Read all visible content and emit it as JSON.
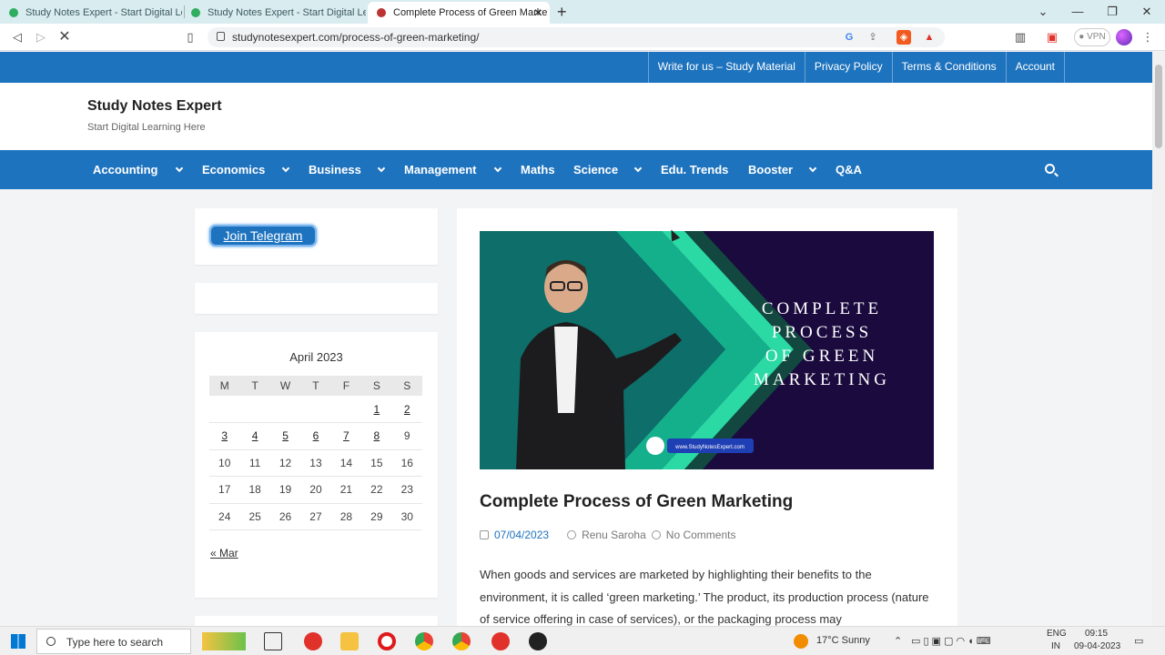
{
  "browser": {
    "tabs": [
      {
        "title": "Study Notes Expert - Start Digital Lear"
      },
      {
        "title": "Study Notes Expert - Start Digital Lear"
      },
      {
        "title": "Complete Process of Green Marke"
      }
    ],
    "url": "studynotesexpert.com/process-of-green-marketing/",
    "vpn_label": "VPN"
  },
  "site": {
    "top_links": [
      "Write for us – Study Material",
      "Privacy Policy",
      "Terms & Conditions",
      "Account"
    ],
    "title": "Study Notes Expert",
    "tagline": "Start Digital Learning Here",
    "nav": [
      "Accounting",
      "Economics",
      "Business",
      "Management",
      "Maths",
      "Science",
      "Edu. Trends",
      "Booster",
      "Q&A"
    ]
  },
  "sidebar": {
    "telegram_label": "Join Telegram",
    "calendar": {
      "caption": "April 2023",
      "weekdays": [
        "M",
        "T",
        "W",
        "T",
        "F",
        "S",
        "S"
      ],
      "prev_link": "« Mar"
    }
  },
  "post": {
    "image_text": "COMPLETE PROCESS OF GREEN MARKETING",
    "image_url_badge": "www.StudyNotesExpert.com",
    "title": "Complete Process of Green Marketing",
    "date": "07/04/2023",
    "author": "Renu Saroha",
    "comments": "No Comments",
    "excerpt": "When goods and services are marketed by highlighting their benefits to the environment, it is called ‘green marketing.’ The product, its production process (nature of service offering in case of services), or the packaging process may"
  },
  "taskbar": {
    "search_placeholder": "Type here to search",
    "weather": "17°C  Sunny",
    "lang": "ENG",
    "region": "IN",
    "time": "09:15",
    "date": "09-04-2023"
  }
}
